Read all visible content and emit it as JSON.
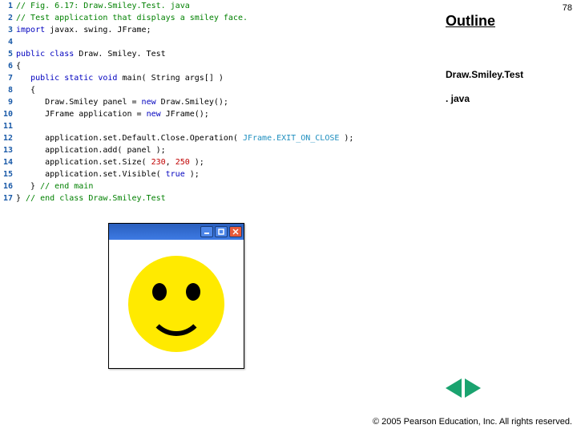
{
  "slide": {
    "outline": "Outline",
    "pageNumber": "78",
    "label1": "Draw.Smiley.Test",
    "label2": ". java",
    "copyright": "© 2005 Pearson Education, Inc.  All rights reserved."
  },
  "code": [
    {
      "n": "1",
      "tokens": [
        [
          "c-comment",
          "// Fig. 6.17: Draw.Smiley.Test. java"
        ]
      ]
    },
    {
      "n": "2",
      "tokens": [
        [
          "c-comment",
          "// Test application that displays a smiley face."
        ]
      ]
    },
    {
      "n": "3",
      "tokens": [
        [
          "c-kw",
          "import"
        ],
        [
          "c-plain",
          " javax. swing. JFrame;"
        ]
      ]
    },
    {
      "n": "4",
      "tokens": [
        [
          "c-plain",
          ""
        ]
      ]
    },
    {
      "n": "5",
      "tokens": [
        [
          "c-kw",
          "public class"
        ],
        [
          "c-plain",
          " Draw. Smiley. Test"
        ]
      ]
    },
    {
      "n": "6",
      "tokens": [
        [
          "c-plain",
          "{"
        ]
      ]
    },
    {
      "n": "7",
      "tokens": [
        [
          "c-plain",
          "   "
        ],
        [
          "c-kw",
          "public static void"
        ],
        [
          "c-plain",
          " main( String args[] )"
        ]
      ]
    },
    {
      "n": "8",
      "tokens": [
        [
          "c-plain",
          "   {"
        ]
      ]
    },
    {
      "n": "9",
      "tokens": [
        [
          "c-plain",
          "      Draw.Smiley panel = "
        ],
        [
          "c-kw",
          "new"
        ],
        [
          "c-plain",
          " Draw.Smiley();"
        ]
      ]
    },
    {
      "n": "10",
      "tokens": [
        [
          "c-plain",
          "      JFrame application = "
        ],
        [
          "c-kw",
          "new"
        ],
        [
          "c-plain",
          " JFrame();"
        ]
      ]
    },
    {
      "n": "11",
      "tokens": [
        [
          "c-plain",
          ""
        ]
      ]
    },
    {
      "n": "12",
      "tokens": [
        [
          "c-plain",
          "      application.set.Default.Close.Operation( "
        ],
        [
          "c-const",
          "JFrame.EXIT_ON_CLOSE"
        ],
        [
          "c-plain",
          " );"
        ]
      ]
    },
    {
      "n": "13",
      "tokens": [
        [
          "c-plain",
          "      application.add( panel );"
        ]
      ]
    },
    {
      "n": "14",
      "tokens": [
        [
          "c-plain",
          "      application.set.Size( "
        ],
        [
          "c-num",
          "230"
        ],
        [
          "c-plain",
          ", "
        ],
        [
          "c-num",
          "250"
        ],
        [
          "c-plain",
          " );"
        ]
      ]
    },
    {
      "n": "15",
      "tokens": [
        [
          "c-plain",
          "      application.set.Visible( "
        ],
        [
          "c-kw",
          "true"
        ],
        [
          "c-plain",
          " );"
        ]
      ]
    },
    {
      "n": "16",
      "tokens": [
        [
          "c-plain",
          "   } "
        ],
        [
          "c-comment",
          "// end main"
        ]
      ]
    },
    {
      "n": "17",
      "tokens": [
        [
          "c-plain",
          "} "
        ],
        [
          "c-comment",
          "// end class Draw.Smiley.Test"
        ]
      ]
    }
  ],
  "window": {
    "buttons": [
      "minimize",
      "maximize",
      "close"
    ]
  }
}
